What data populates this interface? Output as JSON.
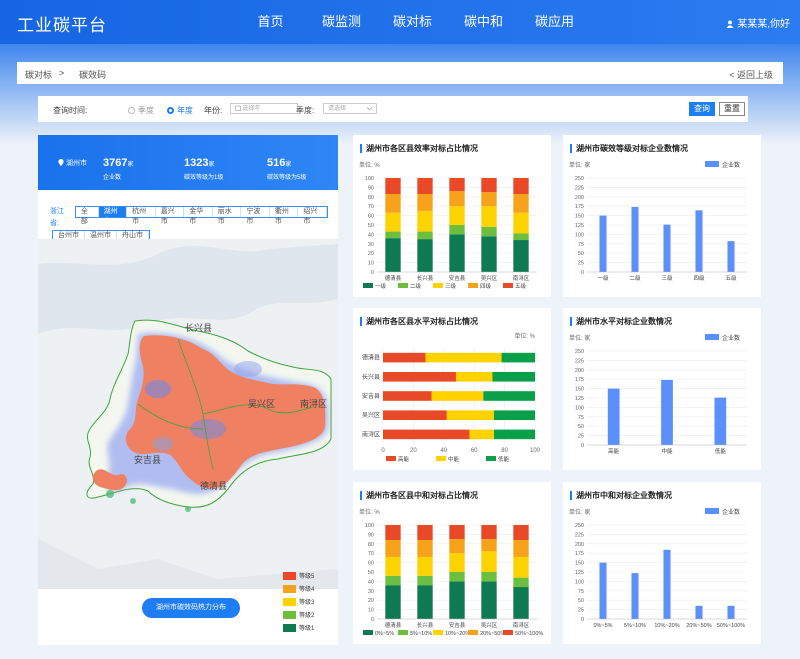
{
  "header": {
    "logo": "工业碳平台",
    "nav": [
      "首页",
      "碳监测",
      "碳对标",
      "碳中和",
      "碳应用"
    ],
    "user": "某某某,你好"
  },
  "breadcrumb": {
    "item1": "碳对标",
    "sep": ">",
    "item2": "碳效码",
    "back": "< 返回上级"
  },
  "filter": {
    "label_time": "查询时间:",
    "radio_quarter": "季度",
    "radio_year": "年度",
    "label_year": "年份:",
    "year_placeholder": "选择年",
    "label_quarter": "季度:",
    "quarter_placeholder": "请选择",
    "query": "查询",
    "reset": "重置"
  },
  "stats": {
    "city": "湖州市",
    "companies": "3767",
    "companies_unit": "家",
    "companies_label": "企业数",
    "grade1": "1323",
    "grade1_unit": "家",
    "grade1_label": "碳效等级为1级",
    "grade5": "516",
    "grade5_unit": "家",
    "grade5_label": "碳效等级为5级"
  },
  "region": {
    "province": "浙江省:",
    "row1": [
      "全部",
      "湖州市",
      "杭州市",
      "嘉兴市",
      "金华市",
      "丽水市",
      "宁波市",
      "衢州市",
      "绍兴市"
    ],
    "row2": [
      "台州市",
      "温州市",
      "舟山市"
    ],
    "selected": "湖州市"
  },
  "map": {
    "button": "湖州市碳效码热力分布",
    "districts": [
      "长兴县",
      "吴兴区",
      "南浔区",
      "安吉县",
      "德清县"
    ],
    "legend": [
      {
        "label": "等级5",
        "color": "#e84a27"
      },
      {
        "label": "等级4",
        "color": "#f7a21b"
      },
      {
        "label": "等级3",
        "color": "#ffd200"
      },
      {
        "label": "等级2",
        "color": "#6cbf3e"
      },
      {
        "label": "等级1",
        "color": "#0e7a52"
      }
    ]
  },
  "chart_data": [
    {
      "id": "c1",
      "type": "bar",
      "stacked": true,
      "title": "湖州市各区县效率对标占比情况",
      "ylabel": "单位: %",
      "ylim": [
        0,
        100
      ],
      "yticks": [
        0,
        10,
        20,
        30,
        40,
        50,
        60,
        70,
        80,
        90,
        100
      ],
      "categories": [
        "德清县",
        "长兴县",
        "安吉县",
        "吴兴区",
        "南浔区"
      ],
      "series": [
        {
          "name": "一级",
          "color": "#0e7a52",
          "values": [
            36,
            35,
            40,
            38,
            34
          ]
        },
        {
          "name": "二级",
          "color": "#6cbf3e",
          "values": [
            7,
            8,
            10,
            10,
            7
          ]
        },
        {
          "name": "三级",
          "color": "#ffd200",
          "values": [
            20,
            22,
            20,
            22,
            22
          ]
        },
        {
          "name": "四级",
          "color": "#f7a21b",
          "values": [
            20,
            18,
            16,
            15,
            20
          ]
        },
        {
          "name": "五级",
          "color": "#e84a27",
          "values": [
            17,
            17,
            14,
            15,
            17
          ]
        }
      ]
    },
    {
      "id": "c2",
      "type": "bar",
      "title": "湖州市碳效等级对标企业数情况",
      "ylabel": "单位: 家",
      "ylim": [
        0,
        250
      ],
      "yticks": [
        0,
        25,
        50,
        75,
        100,
        125,
        150,
        175,
        200,
        225,
        250
      ],
      "categories": [
        "一级",
        "二级",
        "三级",
        "四级",
        "五级"
      ],
      "series": [
        {
          "name": "企业数",
          "color": "#5b8ff9",
          "values": [
            150,
            173,
            126,
            164,
            82
          ]
        }
      ]
    },
    {
      "id": "c3",
      "type": "bar",
      "horizontal": true,
      "stacked": true,
      "title": "湖州市各区县水平对标占比情况",
      "ylabel": "单位: %",
      "xlim": [
        0,
        100
      ],
      "xticks": [
        0,
        20,
        40,
        60,
        80,
        100
      ],
      "categories": [
        "德清县",
        "长兴县",
        "安吉县",
        "吴兴区",
        "南浔区"
      ],
      "series": [
        {
          "name": "高能",
          "color": "#e84a27",
          "values": [
            28,
            48,
            32,
            42,
            57
          ]
        },
        {
          "name": "中能",
          "color": "#ffd200",
          "values": [
            50,
            24,
            34,
            31,
            16
          ]
        },
        {
          "name": "低能",
          "color": "#0aa04a",
          "values": [
            22,
            28,
            34,
            27,
            27
          ]
        }
      ]
    },
    {
      "id": "c4",
      "type": "bar",
      "title": "湖州市水平对标企业数情况",
      "ylabel": "单位: 家",
      "ylim": [
        0,
        250
      ],
      "yticks": [
        0,
        25,
        50,
        75,
        100,
        125,
        150,
        175,
        200,
        225,
        250
      ],
      "categories": [
        "高能",
        "中能",
        "低能"
      ],
      "series": [
        {
          "name": "企业数",
          "color": "#5b8ff9",
          "values": [
            150,
            173,
            126
          ]
        }
      ]
    },
    {
      "id": "c5",
      "type": "bar",
      "stacked": true,
      "title": "湖州市各区县中和对标占比情况",
      "ylabel": "单位: %",
      "ylim": [
        0,
        100
      ],
      "yticks": [
        0,
        10,
        20,
        30,
        40,
        50,
        60,
        70,
        80,
        90,
        100
      ],
      "categories": [
        "德清县",
        "长兴县",
        "安吉县",
        "吴兴区",
        "南浔区"
      ],
      "series": [
        {
          "name": "0%~5%",
          "color": "#0e7a52",
          "values": [
            36,
            36,
            40,
            40,
            34
          ]
        },
        {
          "name": "5%~10%",
          "color": "#6cbf3e",
          "values": [
            10,
            10,
            10,
            10,
            10
          ]
        },
        {
          "name": "10%~20%",
          "color": "#ffd200",
          "values": [
            20,
            20,
            20,
            22,
            22
          ]
        },
        {
          "name": "20%~50%",
          "color": "#f7a21b",
          "values": [
            18,
            18,
            15,
            13,
            18
          ]
        },
        {
          "name": "50%~100%",
          "color": "#e84a27",
          "values": [
            16,
            16,
            15,
            15,
            16
          ]
        }
      ]
    },
    {
      "id": "c6",
      "type": "bar",
      "title": "湖州市中和对标企业数情况",
      "ylabel": "单位: 家",
      "ylim": [
        0,
        250
      ],
      "yticks": [
        0,
        25,
        50,
        75,
        100,
        125,
        150,
        175,
        200,
        225,
        250
      ],
      "categories": [
        "0%~5%",
        "5%~10%",
        "10%~20%",
        "20%~50%",
        "50%~100%"
      ],
      "series": [
        {
          "name": "企业数",
          "color": "#5b8ff9",
          "values": [
            150,
            122,
            184,
            35,
            35
          ]
        }
      ]
    }
  ]
}
